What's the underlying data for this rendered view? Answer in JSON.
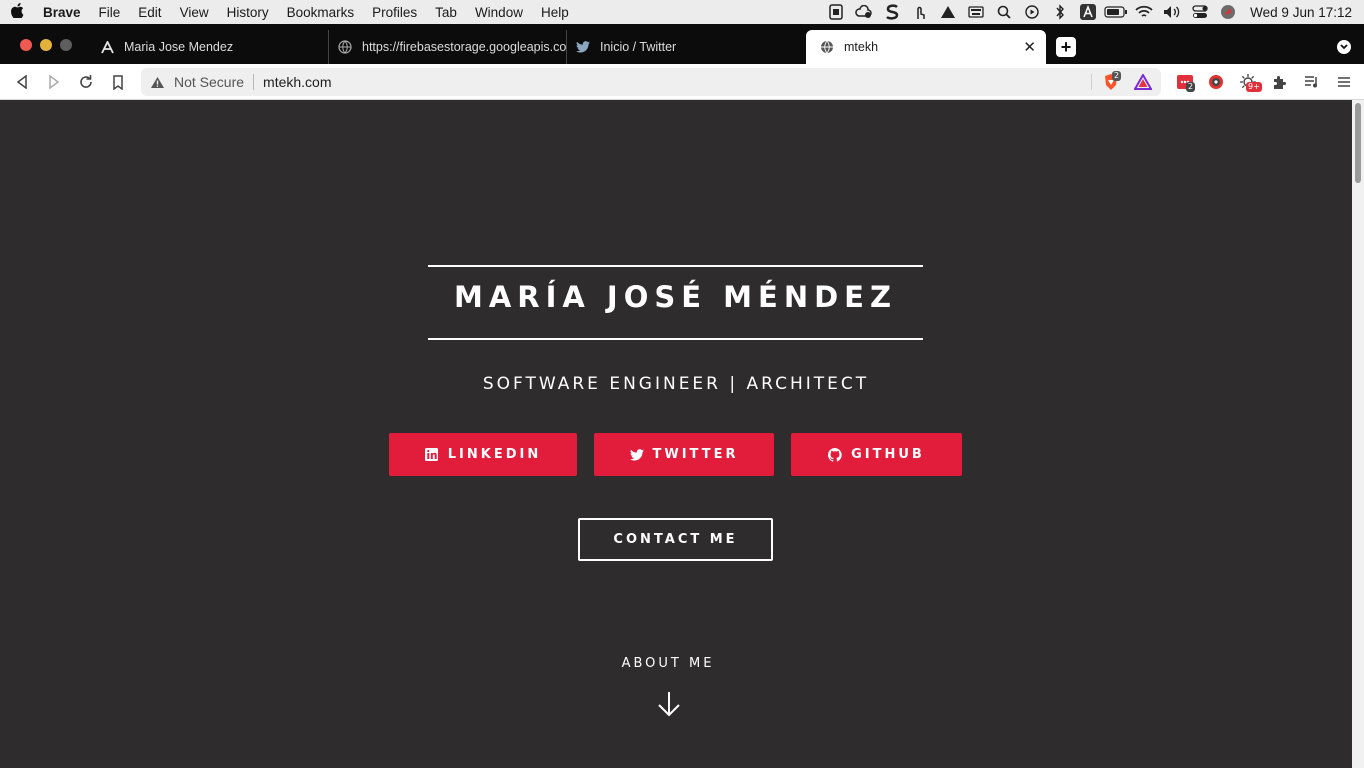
{
  "menubar": {
    "app": "Brave",
    "items": [
      "File",
      "Edit",
      "View",
      "History",
      "Bookmarks",
      "Profiles",
      "Tab",
      "Window",
      "Help"
    ],
    "clock": "Wed 9 Jun  17:12"
  },
  "tabs": [
    {
      "label": "Maria Jose Mendez"
    },
    {
      "label": "https://firebasestorage.googleapis.com"
    },
    {
      "label": "Inicio / Twitter"
    },
    {
      "label": "mtekh",
      "active": true
    }
  ],
  "toolbar": {
    "security_label": "Not Secure",
    "url": "mtekh.com",
    "shield_count": "2",
    "ext_badge_1": "2",
    "ext_badge_2": "9+"
  },
  "hero": {
    "name": "MARÍA JOSÉ MÉNDEZ",
    "subtitle": "SOFTWARE ENGINEER | ARCHITECT",
    "buttons": [
      {
        "label": "LINKEDIN",
        "icon": "linkedin-icon"
      },
      {
        "label": "TWITTER",
        "icon": "twitter-icon"
      },
      {
        "label": "GITHUB",
        "icon": "github-icon"
      }
    ],
    "contact_label": "CONTACT ME",
    "about_label": "ABOUT ME"
  },
  "colors": {
    "page_bg": "#2e2c2d",
    "accent": "#e21d3c",
    "text": "#ffffff"
  }
}
